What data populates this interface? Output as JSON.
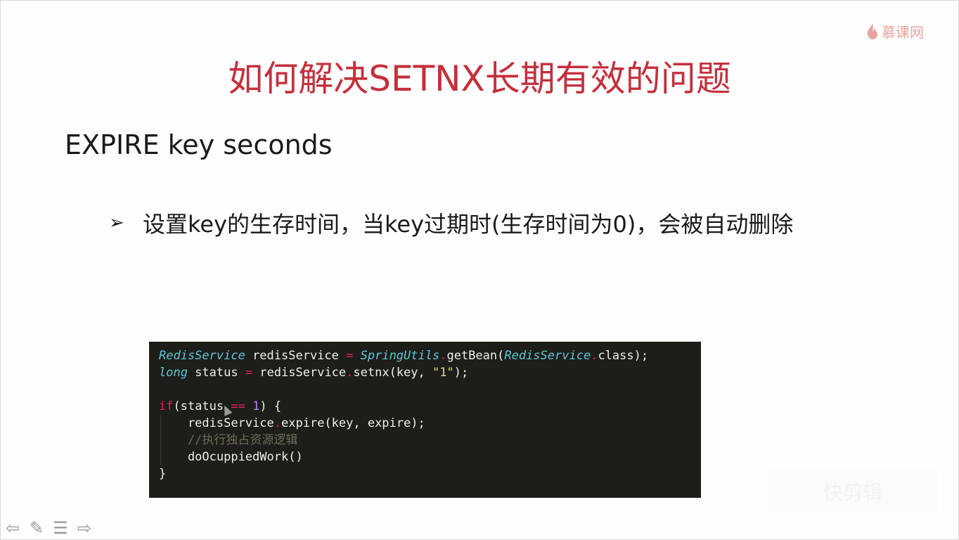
{
  "logo": {
    "text": "慕课网"
  },
  "slide": {
    "title": "如何解决SETNX长期有效的问题",
    "subtitle": "EXPIRE key seconds",
    "bullet": "设置key的生存时间，当key过期时(生存时间为0)，会被自动删除"
  },
  "code": {
    "l1": {
      "a": "RedisService",
      "b": " redisService ",
      "c": "=",
      "d": " ",
      "e": "SpringUtils",
      "f": ".",
      "g": "getBean(",
      "h": "RedisService",
      "i": ".",
      "j": "class);"
    },
    "l2": {
      "a": "long",
      "b": " status ",
      "c": "=",
      "d": " redisService",
      "e": ".",
      "f": "setnx(key, ",
      "g": "\"1\"",
      "h": ");"
    },
    "l4": {
      "a": "if",
      "b": "(status ",
      "c": "==",
      "d": " ",
      "e": "1",
      "f": ") {"
    },
    "l5": {
      "a": "    redisService",
      "b": ".",
      "c": "expire(key, expire);"
    },
    "l6": "    //执行独占资源逻辑",
    "l7": "    doOcuppiedWork()",
    "l8": "}"
  },
  "watermark": "快剪辑",
  "nav": {
    "prev": "⇦",
    "pen": "✎",
    "menu": "☰",
    "next": "⇨"
  }
}
